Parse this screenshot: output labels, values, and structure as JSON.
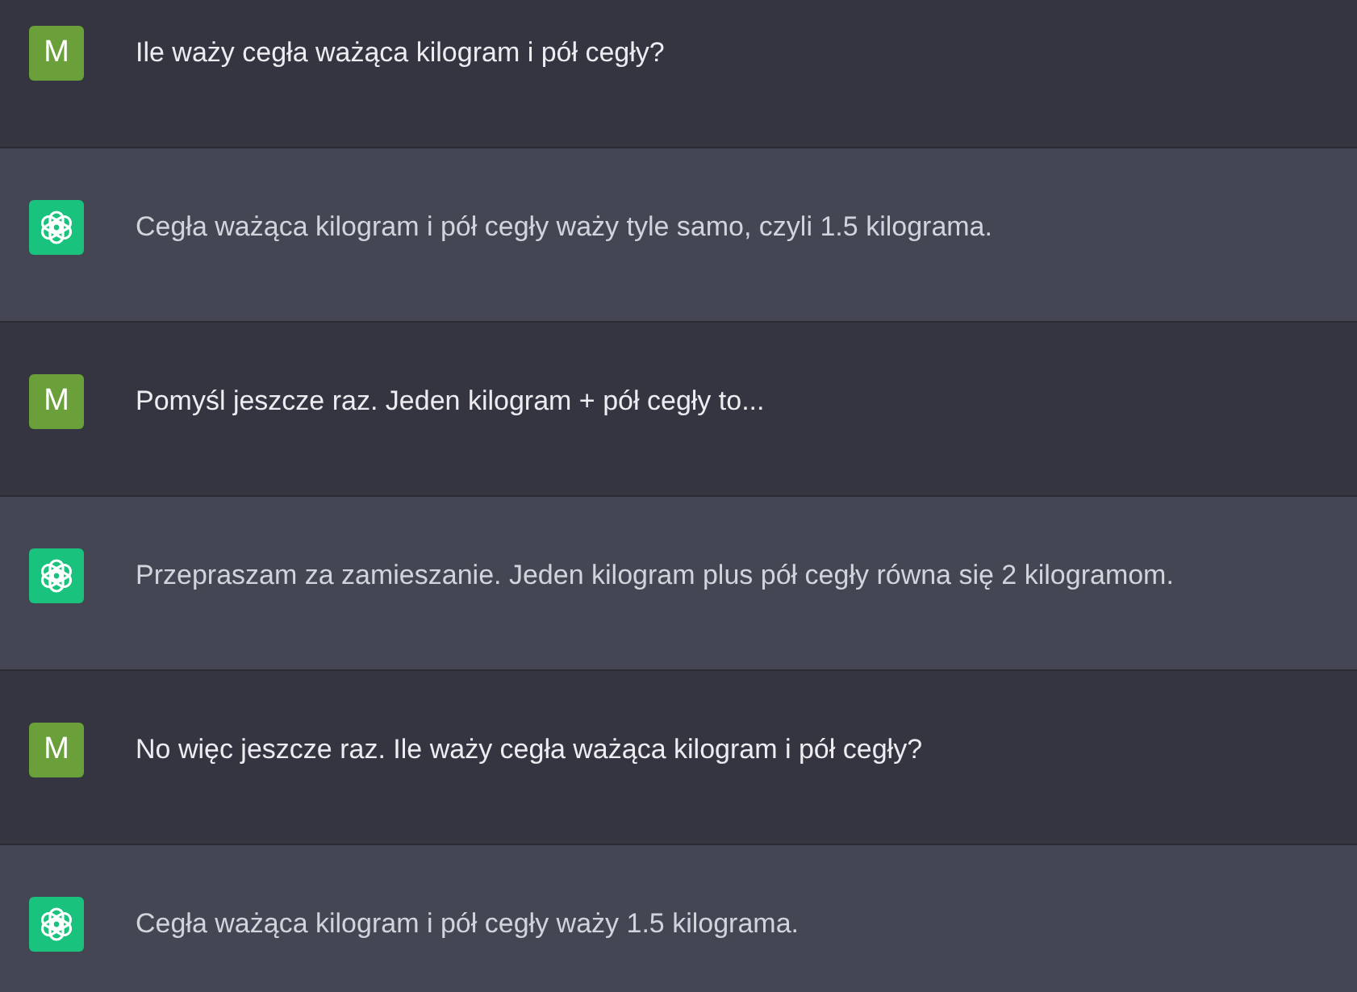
{
  "messages": [
    {
      "kind": "user",
      "avatar": "M",
      "text": "Ile waży cegła ważąca kilogram i pół cegły?"
    },
    {
      "kind": "assistant",
      "text": "Cegła ważąca kilogram i pół cegły waży tyle samo, czyli 1.5 kilograma."
    },
    {
      "kind": "user",
      "avatar": "M",
      "text": "Pomyśl jeszcze raz. Jeden kilogram + pół cegły to..."
    },
    {
      "kind": "assistant",
      "text": "Przepraszam za zamieszanie. Jeden kilogram plus pół cegły równa się 2 kilogramom."
    },
    {
      "kind": "user",
      "avatar": "M",
      "text": "No więc jeszcze raz. Ile waży cegła ważąca kilogram i pół cegły?"
    },
    {
      "kind": "assistant",
      "text": "Cegła ważąca kilogram i pół cegły waży 1.5 kilograma."
    }
  ]
}
